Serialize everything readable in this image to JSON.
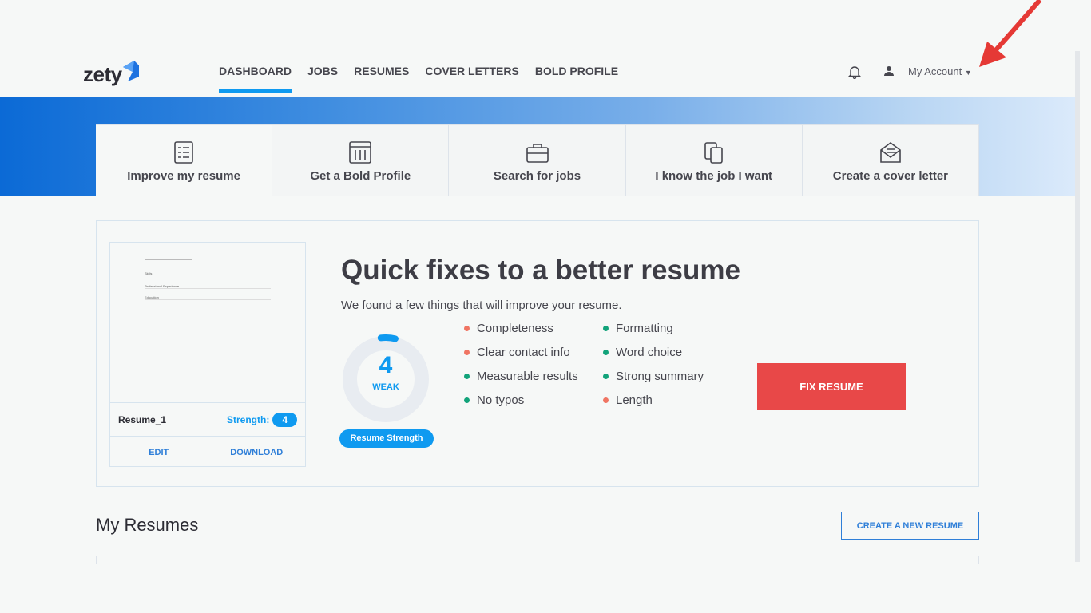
{
  "header": {
    "logo": "zety",
    "nav": [
      {
        "label": "DASHBOARD",
        "active": true
      },
      {
        "label": "JOBS"
      },
      {
        "label": "RESUMES"
      },
      {
        "label": "COVER LETTERS"
      },
      {
        "label": "BOLD PROFILE"
      }
    ],
    "account": "My Account"
  },
  "tabs": [
    {
      "label": "Improve my resume",
      "icon": "checklist-icon"
    },
    {
      "label": "Get a Bold Profile",
      "icon": "browser-columns-icon"
    },
    {
      "label": "Search for jobs",
      "icon": "briefcase-icon"
    },
    {
      "label": "I know the job I want",
      "icon": "clipboard-copy-icon"
    },
    {
      "label": "Create a cover letter",
      "icon": "envelope-icon"
    }
  ],
  "resume": {
    "preview_sections": [
      "Skills",
      "Professional Experience",
      "Education"
    ],
    "name": "Resume_1",
    "strength_label": "Strength:",
    "strength": "4",
    "edit": "EDIT",
    "download": "DOWNLOAD"
  },
  "quickfix": {
    "title": "Quick fixes to a better resume",
    "subtitle": "We found a few things that will improve your resume.",
    "score": "4",
    "score_fraction": 0.04,
    "level": "WEAK",
    "badge": "Resume Strength",
    "checks": [
      {
        "label": "Completeness",
        "status": "fail"
      },
      {
        "label": "Formatting",
        "status": "pass"
      },
      {
        "label": "Clear contact info",
        "status": "fail"
      },
      {
        "label": "Word choice",
        "status": "pass"
      },
      {
        "label": "Measurable results",
        "status": "pass"
      },
      {
        "label": "Strong summary",
        "status": "pass"
      },
      {
        "label": "No typos",
        "status": "pass"
      },
      {
        "label": "Length",
        "status": "fail"
      }
    ],
    "fix_button": "FIX RESUME"
  },
  "my_resumes": {
    "title": "My Resumes",
    "create_button": "CREATE A NEW RESUME"
  },
  "colors": {
    "accent": "#0f9af0",
    "fix": "#e84848",
    "pass": "#12a37a",
    "fail": "#f07563"
  }
}
